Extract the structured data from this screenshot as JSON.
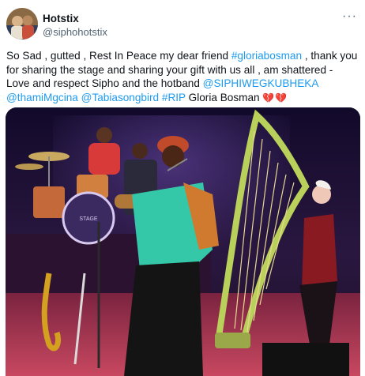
{
  "tweet": {
    "display_name": "Hotstix",
    "handle": "@siphohotstix",
    "more_glyph": "···",
    "text": {
      "line1_plain": "So Sad , gutted , Rest In Peace my dear friend ",
      "line1_link": "#gloriabosman",
      "line1_tail": " , thank you",
      "line2": "for sharing the stage and sharing your gift with us all , am shattered -",
      "line3_plain": "Love and respect Sipho and the hotband ",
      "line3_link": "@SIPHIWEGKUBHEKA",
      "line4_link1": "@thamiMgcina",
      "line4_link2": "@Tabiasongbird",
      "line4_link3": "#RIP",
      "line4_plain": "Gloria Bosman",
      "line4_emoji": "💔💔"
    }
  },
  "media": {
    "drum_head_text": "STAGE"
  },
  "colors": {
    "link": "#1d9bf0",
    "text": "#0f1419",
    "secondary": "#536471",
    "stage_floor": "#9b2f4a"
  }
}
